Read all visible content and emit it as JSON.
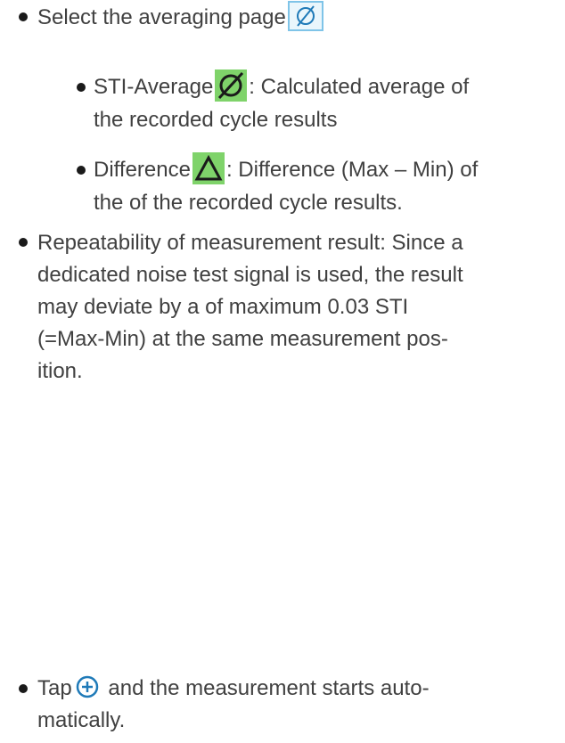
{
  "items": [
    {
      "before": "Select the averaging page",
      "icon": "averaging-page-icon"
    },
    {
      "label": "STI-Average",
      "icon": "sti-average-icon",
      "after_line1": ": Calculated average of",
      "line2": "the recorded cycle results"
    },
    {
      "label": "Difference",
      "icon": "difference-icon",
      "after_line1": ": Difference (Max – Min) of",
      "line2": "the of the recorded cycle results."
    },
    {
      "lines": [
        "Repeatability of measurement result: Since a",
        "dedicated noise test signal is used, the result",
        "may deviate by a of maximum 0.03 STI",
        "(=Max-Min) at the same measurement pos-",
        "ition."
      ]
    },
    {
      "before": "Tap",
      "icon": "add-circle-icon",
      "after_line1": " and the measurement starts auto-",
      "line2": "matically."
    }
  ],
  "colors": {
    "text": "#404040",
    "icon_blue": "#1f7ab8",
    "icon_green": "#7fd36a",
    "icon_border": "#7fc4e8"
  }
}
